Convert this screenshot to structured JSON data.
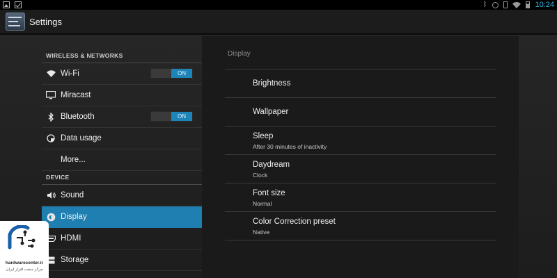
{
  "status_bar": {
    "time": "10:24",
    "left_icons": [
      "image-notification-icon",
      "checkbox-notification-icon"
    ],
    "right_icons": [
      "bluetooth-icon",
      "sync-icon",
      "vibrate-icon",
      "wifi-icon",
      "battery-icon"
    ]
  },
  "action_bar": {
    "title": "Settings",
    "icon": "settings-app-icon"
  },
  "sidebar": {
    "categories": [
      {
        "label": "WIRELESS & NETWORKS"
      },
      {
        "label": "DEVICE"
      }
    ],
    "items": [
      {
        "label": "Wi-Fi",
        "icon": "wifi-icon",
        "toggle": "ON"
      },
      {
        "label": "Miracast",
        "icon": "display-screen-icon"
      },
      {
        "label": "Bluetooth",
        "icon": "bluetooth-icon",
        "toggle": "ON"
      },
      {
        "label": "Data usage",
        "icon": "data-usage-icon"
      },
      {
        "label": "More..."
      },
      {
        "label": "Sound",
        "icon": "speaker-icon"
      },
      {
        "label": "Display",
        "icon": "brightness-icon",
        "selected": true
      },
      {
        "label": "HDMI",
        "icon": "hdmi-icon"
      },
      {
        "label": "Storage",
        "icon": "storage-icon"
      }
    ]
  },
  "main": {
    "title": "Display",
    "preferences": [
      {
        "title": "Brightness",
        "summary": ""
      },
      {
        "title": "Wallpaper",
        "summary": ""
      },
      {
        "title": "Sleep",
        "summary": "After 30 minutes of inactivity"
      },
      {
        "title": "Daydream",
        "summary": "Clock"
      },
      {
        "title": "Font size",
        "summary": "Normal"
      },
      {
        "title": "Color Correction preset",
        "summary": "Native"
      }
    ]
  },
  "watermark": {
    "site": "hardwarecenter.ir",
    "subtitle": "مرکز سخت افزار ایران"
  },
  "colors": {
    "accent": "#1e85b8",
    "selected": "#1e7fb0",
    "time": "#33b5e5"
  }
}
